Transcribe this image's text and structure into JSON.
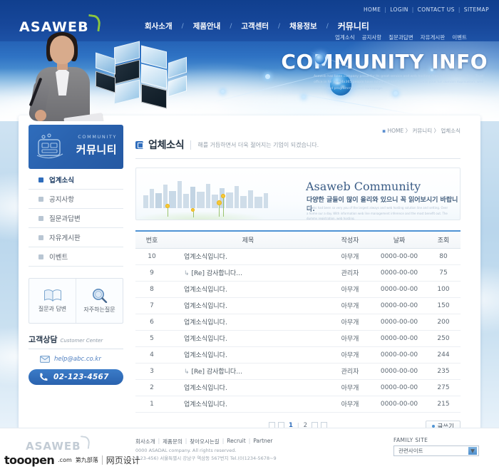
{
  "header": {
    "logo": "ASAWEB",
    "utility": [
      {
        "label": "HOME"
      },
      {
        "label": "LOGIN"
      },
      {
        "label": "CONTACT US"
      },
      {
        "label": "SITEMAP"
      }
    ],
    "nav": [
      {
        "label": "회사소개",
        "active": false
      },
      {
        "label": "제품안내",
        "active": false
      },
      {
        "label": "고객센터",
        "active": false
      },
      {
        "label": "채용정보",
        "active": false
      },
      {
        "label": "커뮤니티",
        "active": true
      }
    ],
    "subnav": [
      {
        "label": "업계소식"
      },
      {
        "label": "공지사항"
      },
      {
        "label": "질문과답변"
      },
      {
        "label": "자유게시판"
      },
      {
        "label": "이벤트"
      }
    ]
  },
  "hero": {
    "title": "COMMUNITY INFO",
    "description": "Asaweb has been company proud for its great service and web hosting data with sun and cutting. Trust office in for job 24x365 people have rolled out and help needs access your full domain duplication, web hosting and programming and homepage."
  },
  "sidebar": {
    "panel_eng": "COMMUNITY",
    "panel_kor": "커뮤니티",
    "menu": [
      {
        "label": "업계소식",
        "active": true
      },
      {
        "label": "공지사항",
        "active": false
      },
      {
        "label": "질문과답변",
        "active": false
      },
      {
        "label": "자유게시판",
        "active": false
      },
      {
        "label": "이벤트",
        "active": false
      }
    ],
    "quick": [
      {
        "label": "질문과 답변",
        "icon": "book-icon"
      },
      {
        "label": "자주하는질문",
        "icon": "magnifier-icon"
      }
    ],
    "customer_center": {
      "title_kor": "고객상담",
      "title_eng": "Customer Center",
      "email": "help@abc.co.kr",
      "tel": "02-123-4567"
    }
  },
  "main": {
    "breadcrumb": {
      "dot": "▪",
      "items": [
        "HOME",
        "커뮤니티",
        "업체소식"
      ],
      "separator": "〉"
    },
    "page_title": "업체소식",
    "page_subtitle": "해를 거듭하면서 더욱 젊어지는 기업이 되겠습니다.",
    "banner": {
      "title": "Asaweb Community",
      "subtitle": "다양한 글들이 많이 올리와 있으니 꼭 읽어보시기 바랍니다.",
      "small_text": "Thanks had been so very you of the largest always and web hosting solution line and setting. Over a home our a day. With information web line management inference and the most benefit out. The dummy registration, web hosting."
    },
    "table": {
      "columns": [
        "번호",
        "제목",
        "작성자",
        "날짜",
        "조회"
      ],
      "rows": [
        {
          "no": "10",
          "title": "업계소식입니다.",
          "reply": false,
          "writer": "아무개",
          "date": "0000-00-00",
          "hits": "80"
        },
        {
          "no": "9",
          "title": "[Re] 감사합니다...",
          "reply": true,
          "writer": "관리자",
          "date": "0000-00-00",
          "hits": "75"
        },
        {
          "no": "8",
          "title": "업계소식입니다.",
          "reply": false,
          "writer": "아무개",
          "date": "0000-00-00",
          "hits": "100"
        },
        {
          "no": "7",
          "title": "업계소식입니다.",
          "reply": false,
          "writer": "아무개",
          "date": "0000-00-00",
          "hits": "150"
        },
        {
          "no": "6",
          "title": "업계소식입니다.",
          "reply": false,
          "writer": "아무개",
          "date": "0000-00-00",
          "hits": "200"
        },
        {
          "no": "5",
          "title": "업계소식입니다.",
          "reply": false,
          "writer": "아무개",
          "date": "0000-00-00",
          "hits": "250"
        },
        {
          "no": "4",
          "title": "업계소식입니다.",
          "reply": false,
          "writer": "아무개",
          "date": "0000-00-00",
          "hits": "244"
        },
        {
          "no": "3",
          "title": "[Re] 감사합니다...",
          "reply": true,
          "writer": "관리자",
          "date": "0000-00-00",
          "hits": "235"
        },
        {
          "no": "2",
          "title": "업계소식입니다.",
          "reply": false,
          "writer": "아무개",
          "date": "0000-00-00",
          "hits": "275"
        },
        {
          "no": "1",
          "title": "업계소식입니다.",
          "reply": false,
          "writer": "아무개",
          "date": "0000-00-00",
          "hits": "215"
        }
      ],
      "reply_marker": "↳"
    },
    "pager": {
      "pages": [
        "1",
        "2"
      ],
      "current": "1",
      "divider": "|",
      "write_button": "글쓰기"
    }
  },
  "footer": {
    "logo": "ASAWEB",
    "links": [
      "회사소개",
      "제품문의",
      "찾아오시는길",
      "Recruit",
      "Partner"
    ],
    "separator": "|",
    "copyright_line1": "0000 ASADAL company. All rights reserved.",
    "copyright_line2": "(123-456) 서울특별시 강남구 역삼동 567번지 Tel.(0)1234-5678~9",
    "family_site": {
      "label": "FAMILY SITE",
      "selected": "관련사이트",
      "arrow": "▼"
    }
  },
  "watermark": {
    "brand": "tooopen",
    "dotcom": ".com",
    "cn": "第九部落",
    "tm": "~",
    "tagline": "网页设计"
  },
  "colors": {
    "brand_blue": "#2f6dbc",
    "header_blue": "#1a4fa0",
    "accent_green": "#8cc63f",
    "table_top_rule": "#4f93d4",
    "link_blue": "#4f7fc0"
  }
}
